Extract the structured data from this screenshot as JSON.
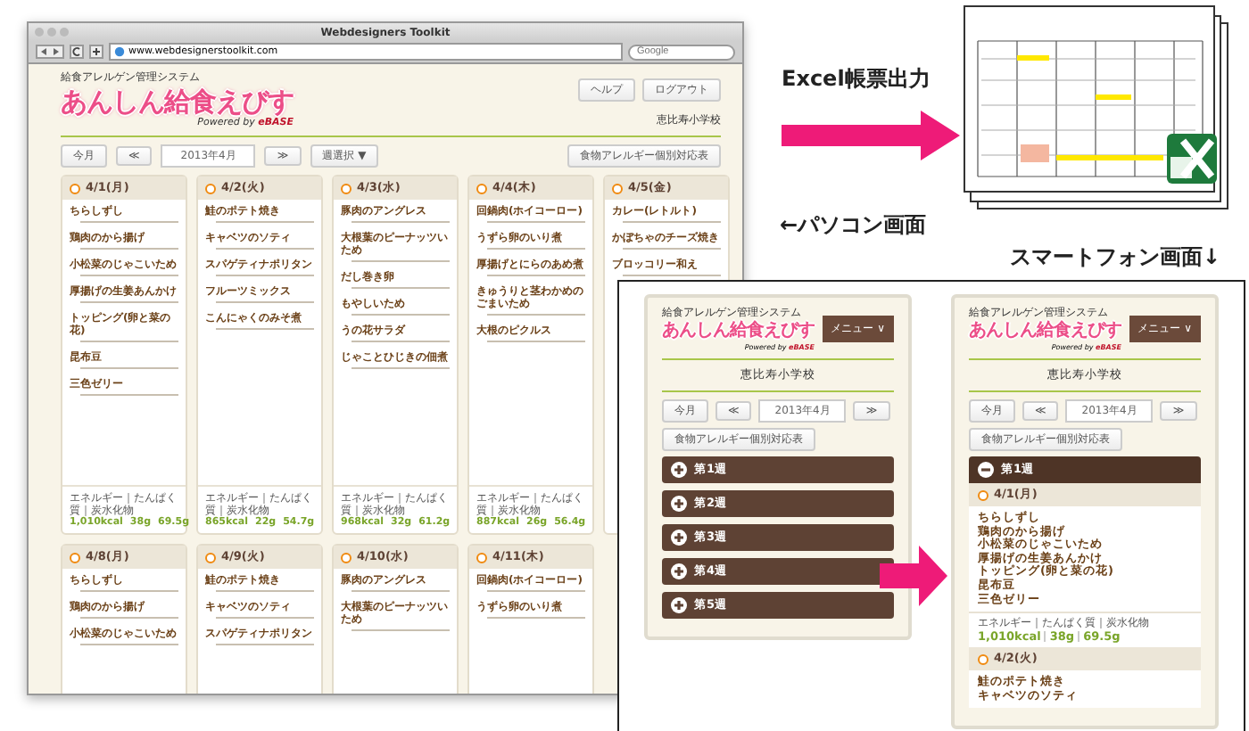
{
  "browser": {
    "title": "Webdesigners Toolkit",
    "url": "www.webdesignerstoolkit.com",
    "search_placeholder": "Google"
  },
  "site": {
    "system_name": "給食アレルゲン管理システム",
    "logo": "あんしん給食えびす",
    "powered_by": "Powered by",
    "brand": "eBASE",
    "buttons": [
      "ヘルプ",
      "ログアウト"
    ],
    "school": "恵比寿小学校",
    "nav": {
      "today": "今月",
      "prev": "≪",
      "month": "2013年4月",
      "next": "≫",
      "week_select": "週選択 ▼",
      "allergy_table": "食物アレルギー個別対応表"
    }
  },
  "days": [
    {
      "date": "4/1(月)",
      "dishes": [
        "ちらしずし",
        "鶏肉のから揚げ",
        "小松菜のじゃこいため",
        "厚揚げの生姜あんかけ",
        "トッピング(卵と菜の花)",
        "昆布豆",
        "三色ゼリー"
      ],
      "nutrition": {
        "label": "エネルギー｜たんぱく質｜炭水化物",
        "values": [
          "1,010kcal",
          "38g",
          "69.5g"
        ]
      }
    },
    {
      "date": "4/2(火)",
      "dishes": [
        "鮭のポテト焼き",
        "キャベツのソティ",
        "スパゲティナポリタン",
        "フルーツミックス",
        "こんにゃくのみそ煮"
      ],
      "nutrition": {
        "label": "エネルギー｜たんぱく質｜炭水化物",
        "values": [
          "865kcal",
          "22g",
          "54.7g"
        ]
      }
    },
    {
      "date": "4/3(水)",
      "dishes": [
        "豚肉のアングレス",
        "大根葉のピーナッツいため",
        "だし巻き卵",
        "もやしいため",
        "うの花サラダ",
        "じゃことひじきの佃煮"
      ],
      "nutrition": {
        "label": "エネルギー｜たんぱく質｜炭水化物",
        "values": [
          "968kcal",
          "32g",
          "61.2g"
        ]
      }
    },
    {
      "date": "4/4(木)",
      "dishes": [
        "回鍋肉(ホイコーロー)",
        "うずら卵のいり煮",
        "厚揚げとにらのあめ煮",
        "きゅうりと茎わかめのごまいため",
        "大根のピクルス"
      ],
      "nutrition": {
        "label": "エネルギー｜たんぱく質｜炭水化物",
        "values": [
          "887kcal",
          "26g",
          "56.4g"
        ]
      }
    },
    {
      "date": "4/5(金)",
      "dishes": [
        "カレー(レトルト)",
        "かぼちゃのチーズ焼き",
        "ブロッコリー和え"
      ]
    },
    {
      "date": "4/8(月)",
      "dishes": [
        "ちらしずし",
        "鶏肉のから揚げ",
        "小松菜のじゃこいため"
      ]
    },
    {
      "date": "4/9(火)",
      "dishes": [
        "鮭のポテト焼き",
        "キャベツのソティ",
        "スパゲティナポリタン"
      ]
    },
    {
      "date": "4/10(水)",
      "dishes": [
        "豚肉のアングレス",
        "大根葉のピーナッツいため"
      ]
    },
    {
      "date": "4/11(木)",
      "dishes": [
        "回鍋肉(ホイコーロー)",
        "うずら卵のいり煮"
      ]
    }
  ],
  "excel": {
    "label": "Excel帳票出力"
  },
  "pc_label": "←パソコン画面",
  "sp_label": "スマートフォン画面↓",
  "phones": [
    {
      "system_name": "給食アレルゲン管理システム",
      "logo": "あんしん給食えびす",
      "powered_by": "Powered by",
      "brand": "eBASE",
      "menu": "メニュー ∨",
      "school": "恵比寿小学校",
      "nav": {
        "today": "今月",
        "prev": "≪",
        "month": "2013年4月",
        "next": "≫",
        "allergy_table": "食物アレルギー個別対応表"
      },
      "weeks": [
        {
          "label": "第1週",
          "expanded": false
        },
        {
          "label": "第2週",
          "expanded": false
        },
        {
          "label": "第3週",
          "expanded": false
        },
        {
          "label": "第4週",
          "expanded": false
        },
        {
          "label": "第5週",
          "expanded": false
        }
      ]
    },
    {
      "system_name": "給食アレルゲン管理システム",
      "logo": "あんしん給食えびす",
      "powered_by": "Powered by",
      "brand": "eBASE",
      "menu": "メニュー ∨",
      "school": "恵比寿小学校",
      "nav": {
        "today": "今月",
        "prev": "≪",
        "month": "2013年4月",
        "next": "≫",
        "allergy_table": "食物アレルギー個別対応表"
      },
      "weeks": [
        {
          "label": "第1週",
          "expanded": true,
          "days": [
            {
              "date": "4/1(月)",
              "dishes": [
                "ちらしずし",
                "鶏肉のから揚げ",
                "小松菜のじゃこいため",
                "厚揚げの生姜あんかけ",
                "トッピング(卵と菜の花)",
                "昆布豆",
                "三色ゼリー"
              ],
              "nutrition": {
                "label": "エネルギー｜たんぱく質｜炭水化物",
                "values": [
                  "1,010kcal",
                  "38g",
                  "69.5g"
                ]
              }
            },
            {
              "date": "4/2(火)",
              "dishes": [
                "鮭のポテト焼き",
                "キャベツのソティ"
              ]
            }
          ]
        }
      ]
    }
  ]
}
